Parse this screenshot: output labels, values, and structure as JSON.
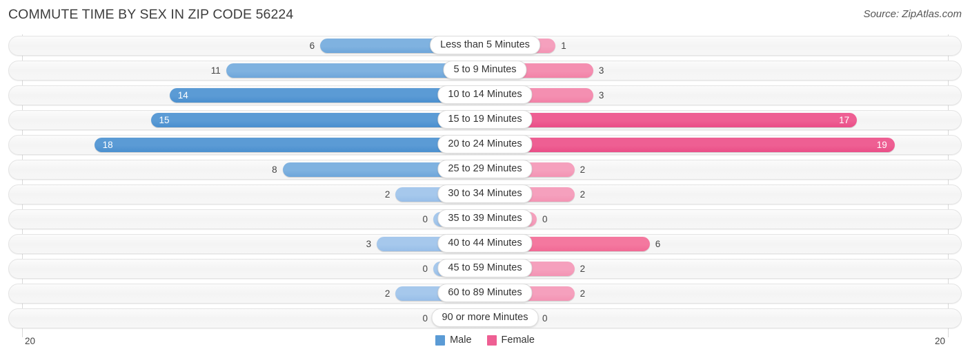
{
  "header": {
    "title": "COMMUTE TIME BY SEX IN ZIP CODE 56224",
    "source": "Source: ZipAtlas.com"
  },
  "legend": {
    "male_label": "Male",
    "female_label": "Female",
    "male_color": "#5b9bd5",
    "female_color": "#ee5f93"
  },
  "axis": {
    "left_tick": "20",
    "right_tick": "20"
  },
  "chart_data": {
    "type": "bar",
    "title": "COMMUTE TIME BY SEX IN ZIP CODE 56224",
    "subtitle": "Source: ZipAtlas.com",
    "orientation": "horizontal-diverging",
    "xlabel": "",
    "ylabel": "",
    "xlim": [
      20,
      20
    ],
    "axis_ticks": [
      "20",
      "20"
    ],
    "grid": true,
    "legend_position": "bottom-center",
    "categories": [
      "Less than 5 Minutes",
      "5 to 9 Minutes",
      "10 to 14 Minutes",
      "15 to 19 Minutes",
      "20 to 24 Minutes",
      "25 to 29 Minutes",
      "30 to 34 Minutes",
      "35 to 39 Minutes",
      "40 to 44 Minutes",
      "45 to 59 Minutes",
      "60 to 89 Minutes",
      "90 or more Minutes"
    ],
    "series": [
      {
        "name": "Male",
        "color": "#5b9bd5",
        "values": [
          6,
          11,
          14,
          15,
          18,
          8,
          2,
          0,
          3,
          0,
          2,
          0
        ]
      },
      {
        "name": "Female",
        "color": "#ee5f93",
        "values": [
          1,
          3,
          3,
          17,
          19,
          2,
          2,
          0,
          6,
          2,
          2,
          0
        ]
      }
    ]
  }
}
